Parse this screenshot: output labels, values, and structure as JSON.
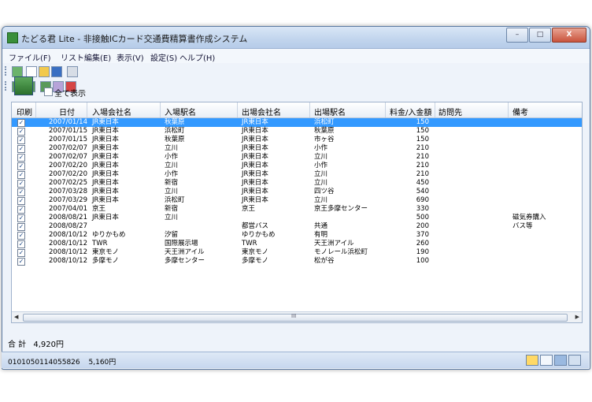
{
  "window": {
    "title": "たどる君  Lite - 非接触ICカード交通費精算書作成システム"
  },
  "window_buttons": {
    "minimize": "–",
    "maximize": "□",
    "close": "X"
  },
  "menu": [
    {
      "label": "ファイル(F)"
    },
    {
      "label": "リスト編集(E)"
    },
    {
      "label": "表示(V)"
    },
    {
      "label": "設定(S)"
    },
    {
      "label": "ヘルプ(H)"
    }
  ],
  "filter": {
    "show_all_label": "全て表示"
  },
  "table": {
    "headers": [
      "印刷",
      "日付",
      "入場会社名",
      "入場駅名",
      "出場会社名",
      "出場駅名",
      "料金/入金額",
      "訪問先",
      "備考"
    ],
    "rows": [
      {
        "print": true,
        "date": "2007/01/14",
        "in_co": "JR東日本",
        "in_st": "秋葉原",
        "out_co": "JR東日本",
        "out_st": "浜松町",
        "fare": "150",
        "visit": "",
        "note": "",
        "selected": true
      },
      {
        "print": true,
        "date": "2007/01/15",
        "in_co": "JR東日本",
        "in_st": "浜松町",
        "out_co": "JR東日本",
        "out_st": "秋葉原",
        "fare": "150",
        "visit": "",
        "note": ""
      },
      {
        "print": true,
        "date": "2007/01/15",
        "in_co": "JR東日本",
        "in_st": "秋葉原",
        "out_co": "JR東日本",
        "out_st": "市ヶ谷",
        "fare": "150",
        "visit": "",
        "note": ""
      },
      {
        "print": true,
        "date": "2007/02/07",
        "in_co": "JR東日本",
        "in_st": "立川",
        "out_co": "JR東日本",
        "out_st": "小作",
        "fare": "210",
        "visit": "",
        "note": ""
      },
      {
        "print": true,
        "date": "2007/02/07",
        "in_co": "JR東日本",
        "in_st": "小作",
        "out_co": "JR東日本",
        "out_st": "立川",
        "fare": "210",
        "visit": "",
        "note": ""
      },
      {
        "print": true,
        "date": "2007/02/20",
        "in_co": "JR東日本",
        "in_st": "立川",
        "out_co": "JR東日本",
        "out_st": "小作",
        "fare": "210",
        "visit": "",
        "note": ""
      },
      {
        "print": true,
        "date": "2007/02/20",
        "in_co": "JR東日本",
        "in_st": "小作",
        "out_co": "JR東日本",
        "out_st": "立川",
        "fare": "210",
        "visit": "",
        "note": ""
      },
      {
        "print": true,
        "date": "2007/02/25",
        "in_co": "JR東日本",
        "in_st": "新宿",
        "out_co": "JR東日本",
        "out_st": "立川",
        "fare": "450",
        "visit": "",
        "note": ""
      },
      {
        "print": true,
        "date": "2007/03/28",
        "in_co": "JR東日本",
        "in_st": "立川",
        "out_co": "JR東日本",
        "out_st": "四ツ谷",
        "fare": "540",
        "visit": "",
        "note": ""
      },
      {
        "print": true,
        "date": "2007/03/29",
        "in_co": "JR東日本",
        "in_st": "浜松町",
        "out_co": "JR東日本",
        "out_st": "立川",
        "fare": "690",
        "visit": "",
        "note": ""
      },
      {
        "print": true,
        "date": "2007/04/01",
        "in_co": "京王",
        "in_st": "新宿",
        "out_co": "京王",
        "out_st": "京王多摩センター",
        "fare": "330",
        "visit": "",
        "note": ""
      },
      {
        "print": true,
        "date": "2008/08/21",
        "in_co": "JR東日本",
        "in_st": "立川",
        "out_co": "",
        "out_st": "",
        "fare": "500",
        "visit": "",
        "note": "磁気券購入"
      },
      {
        "print": true,
        "date": "2008/08/27",
        "in_co": "",
        "in_st": "",
        "out_co": "都営バス",
        "out_st": "共通",
        "fare": "200",
        "visit": "",
        "note": "バス等"
      },
      {
        "print": true,
        "date": "2008/10/12",
        "in_co": "ゆりかもめ",
        "in_st": "汐留",
        "out_co": "ゆりかもめ",
        "out_st": "有明",
        "fare": "370",
        "visit": "",
        "note": ""
      },
      {
        "print": true,
        "date": "2008/10/12",
        "in_co": "TWR",
        "in_st": "国際展示場",
        "out_co": "TWR",
        "out_st": "天王洲アイル",
        "fare": "260",
        "visit": "",
        "note": ""
      },
      {
        "print": true,
        "date": "2008/10/12",
        "in_co": "東京モノ",
        "in_st": "天王洲アイル",
        "out_co": "東京モノ",
        "out_st": "モノレール浜松町",
        "fare": "190",
        "visit": "",
        "note": ""
      },
      {
        "print": true,
        "date": "2008/10/12",
        "in_co": "多摩モノ",
        "in_st": "多摩センター",
        "out_co": "多摩モノ",
        "out_st": "松が谷",
        "fare": "100",
        "visit": "",
        "note": ""
      }
    ]
  },
  "scrollbar": {
    "grip": "III",
    "left": "◀",
    "right": "▶"
  },
  "total": {
    "label": "合 計",
    "value": "4,920円"
  },
  "status": {
    "card_id": "0101050114055826",
    "balance": "5,160円"
  }
}
